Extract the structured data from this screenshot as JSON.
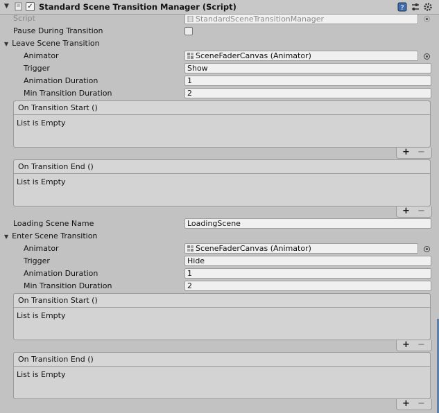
{
  "header": {
    "title": "Standard Scene Transition Manager (Script)",
    "icons": [
      "fold-arrow-icon",
      "script-component-icon",
      "enabled-checkbox",
      "help-icon",
      "preset-icon",
      "gear-icon"
    ]
  },
  "script_row": {
    "label": "Script",
    "value": "StandardSceneTransitionManager"
  },
  "pause_row": {
    "label": "Pause During Transition",
    "checked": false
  },
  "leave": {
    "label": "Leave Scene Transition",
    "animator": {
      "label": "Animator",
      "value": "SceneFaderCanvas (Animator)"
    },
    "trigger": {
      "label": "Trigger",
      "value": "Show"
    },
    "duration": {
      "label": "Animation Duration",
      "value": "1"
    },
    "min_duration": {
      "label": "Min Transition Duration",
      "value": "2"
    },
    "start_event": {
      "title": "On Transition Start ()",
      "body": "List is Empty"
    },
    "end_event": {
      "title": "On Transition End ()",
      "body": "List is Empty"
    }
  },
  "loading": {
    "label": "Loading Scene Name",
    "value": "LoadingScene"
  },
  "enter": {
    "label": "Enter Scene Transition",
    "animator": {
      "label": "Animator",
      "value": "SceneFaderCanvas (Animator)"
    },
    "trigger": {
      "label": "Trigger",
      "value": "Hide"
    },
    "duration": {
      "label": "Animation Duration",
      "value": "1"
    },
    "min_duration": {
      "label": "Min Transition Duration",
      "value": "2"
    },
    "start_event": {
      "title": "On Transition Start ()",
      "body": "List is Empty"
    },
    "end_event": {
      "title": "On Transition End ()",
      "body": "List is Empty"
    }
  },
  "list_controls": {
    "plus": "+",
    "minus": "−"
  }
}
